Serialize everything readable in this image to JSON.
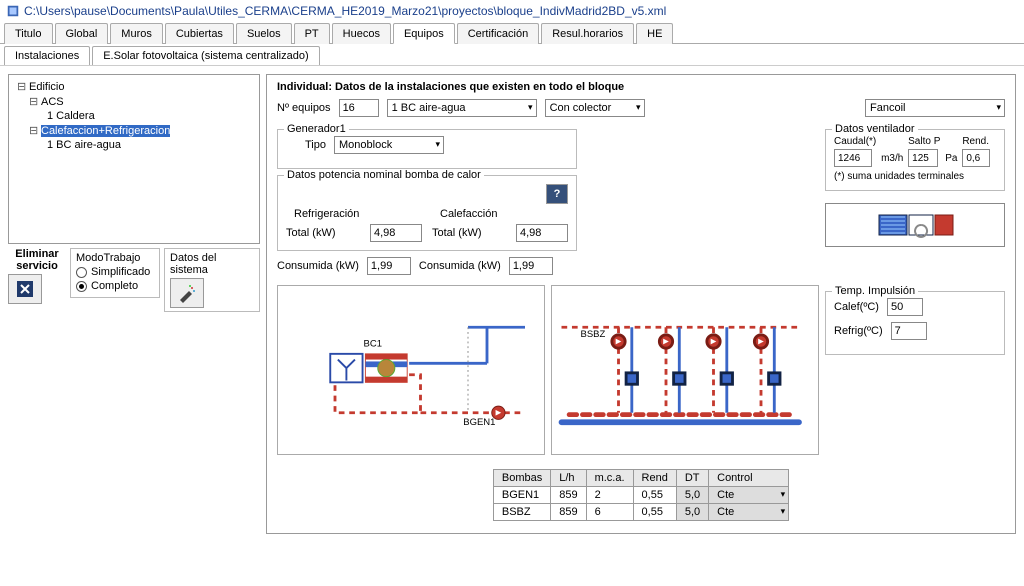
{
  "window": {
    "path": "C:\\Users\\pause\\Documents\\Paula\\Utiles_CERMA\\CERMA_HE2019_Marzo21\\proyectos\\bloque_IndivMadrid2BD_v5.xml"
  },
  "tabs": [
    "Titulo",
    "Global",
    "Muros",
    "Cubiertas",
    "Suelos",
    "PT",
    "Huecos",
    "Equipos",
    "Certificación",
    "Resul.horarios",
    "HE"
  ],
  "active_tab": "Equipos",
  "subtabs": [
    "Instalaciones",
    "E.Solar fotovoltaica (sistema centralizado)"
  ],
  "active_subtab": "Instalaciones",
  "tree": {
    "root": "Edificio",
    "nodes": [
      {
        "label": "ACS",
        "children": [
          {
            "label": "1 Caldera"
          }
        ]
      },
      {
        "label": "Calefaccion+Refrigeracion",
        "selected": true,
        "children": [
          {
            "label": "1 BC aire-agua"
          }
        ]
      }
    ]
  },
  "eliminar_label": "Eliminar servicio",
  "modo": {
    "title": "ModoTrabajo",
    "opt1": "Simplificado",
    "opt2": "Completo",
    "selected": "Completo"
  },
  "datos_sistema": {
    "title": "Datos del sistema"
  },
  "main": {
    "title": "Individual: Datos de la instalaciones que existen en todo el bloque",
    "n_equipos_label": "Nº equipos",
    "n_equipos": "16",
    "tipo_bc": "1 BC aire-agua",
    "colector": "Con colector",
    "terminal": "Fancoil",
    "gen": {
      "title": "Generador1",
      "tipo_label": "Tipo",
      "tipo": "Monoblock"
    },
    "pot": {
      "title": "Datos potencia nominal bomba de calor",
      "refrig": "Refrigeración",
      "calef": "Calefacción",
      "total_label": "Total (kW)",
      "total_r": "4,98",
      "total_c": "4,98",
      "cons_label": "Consumida (kW)",
      "cons_r": "1,99",
      "cons_c": "1,99"
    },
    "vent": {
      "title": "Datos ventilador",
      "caudal_label": "Caudal(*)",
      "caudal": "1246",
      "caudal_unit": "m3/h",
      "salto_label": "Salto P",
      "salto": "125",
      "salto_unit": "Pa",
      "rend_label": "Rend.",
      "rend": "0,6",
      "note": "(*) suma unidades terminales"
    },
    "temp": {
      "title": "Temp. Impulsión",
      "calef_label": "Calef(ºC)",
      "calef": "50",
      "refrig_label": "Refrig(ºC)",
      "refrig": "7"
    },
    "diagram": {
      "bc": "BC1",
      "bgen": "BGEN1",
      "bsbz": "BSBZ"
    },
    "table": {
      "headers": [
        "Bombas",
        "L/h",
        "m.c.a.",
        "Rend",
        "DT",
        "Control"
      ],
      "rows": [
        {
          "name": "BGEN1",
          "lh": "859",
          "mca": "2",
          "rend": "0,55",
          "dt": "5,0",
          "ctrl": "Cte"
        },
        {
          "name": "BSBZ",
          "lh": "859",
          "mca": "6",
          "rend": "0,55",
          "dt": "5,0",
          "ctrl": "Cte"
        }
      ]
    }
  }
}
